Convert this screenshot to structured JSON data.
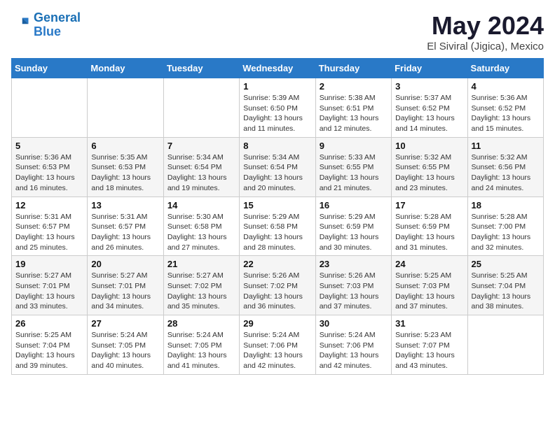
{
  "logo": {
    "line1": "General",
    "line2": "Blue"
  },
  "title": "May 2024",
  "location": "El Siviral (Jigica), Mexico",
  "weekdays": [
    "Sunday",
    "Monday",
    "Tuesday",
    "Wednesday",
    "Thursday",
    "Friday",
    "Saturday"
  ],
  "weeks": [
    [
      {
        "day": "",
        "info": ""
      },
      {
        "day": "",
        "info": ""
      },
      {
        "day": "",
        "info": ""
      },
      {
        "day": "1",
        "info": "Sunrise: 5:39 AM\nSunset: 6:50 PM\nDaylight: 13 hours\nand 11 minutes."
      },
      {
        "day": "2",
        "info": "Sunrise: 5:38 AM\nSunset: 6:51 PM\nDaylight: 13 hours\nand 12 minutes."
      },
      {
        "day": "3",
        "info": "Sunrise: 5:37 AM\nSunset: 6:52 PM\nDaylight: 13 hours\nand 14 minutes."
      },
      {
        "day": "4",
        "info": "Sunrise: 5:36 AM\nSunset: 6:52 PM\nDaylight: 13 hours\nand 15 minutes."
      }
    ],
    [
      {
        "day": "5",
        "info": "Sunrise: 5:36 AM\nSunset: 6:53 PM\nDaylight: 13 hours\nand 16 minutes."
      },
      {
        "day": "6",
        "info": "Sunrise: 5:35 AM\nSunset: 6:53 PM\nDaylight: 13 hours\nand 18 minutes."
      },
      {
        "day": "7",
        "info": "Sunrise: 5:34 AM\nSunset: 6:54 PM\nDaylight: 13 hours\nand 19 minutes."
      },
      {
        "day": "8",
        "info": "Sunrise: 5:34 AM\nSunset: 6:54 PM\nDaylight: 13 hours\nand 20 minutes."
      },
      {
        "day": "9",
        "info": "Sunrise: 5:33 AM\nSunset: 6:55 PM\nDaylight: 13 hours\nand 21 minutes."
      },
      {
        "day": "10",
        "info": "Sunrise: 5:32 AM\nSunset: 6:55 PM\nDaylight: 13 hours\nand 23 minutes."
      },
      {
        "day": "11",
        "info": "Sunrise: 5:32 AM\nSunset: 6:56 PM\nDaylight: 13 hours\nand 24 minutes."
      }
    ],
    [
      {
        "day": "12",
        "info": "Sunrise: 5:31 AM\nSunset: 6:57 PM\nDaylight: 13 hours\nand 25 minutes."
      },
      {
        "day": "13",
        "info": "Sunrise: 5:31 AM\nSunset: 6:57 PM\nDaylight: 13 hours\nand 26 minutes."
      },
      {
        "day": "14",
        "info": "Sunrise: 5:30 AM\nSunset: 6:58 PM\nDaylight: 13 hours\nand 27 minutes."
      },
      {
        "day": "15",
        "info": "Sunrise: 5:29 AM\nSunset: 6:58 PM\nDaylight: 13 hours\nand 28 minutes."
      },
      {
        "day": "16",
        "info": "Sunrise: 5:29 AM\nSunset: 6:59 PM\nDaylight: 13 hours\nand 30 minutes."
      },
      {
        "day": "17",
        "info": "Sunrise: 5:28 AM\nSunset: 6:59 PM\nDaylight: 13 hours\nand 31 minutes."
      },
      {
        "day": "18",
        "info": "Sunrise: 5:28 AM\nSunset: 7:00 PM\nDaylight: 13 hours\nand 32 minutes."
      }
    ],
    [
      {
        "day": "19",
        "info": "Sunrise: 5:27 AM\nSunset: 7:01 PM\nDaylight: 13 hours\nand 33 minutes."
      },
      {
        "day": "20",
        "info": "Sunrise: 5:27 AM\nSunset: 7:01 PM\nDaylight: 13 hours\nand 34 minutes."
      },
      {
        "day": "21",
        "info": "Sunrise: 5:27 AM\nSunset: 7:02 PM\nDaylight: 13 hours\nand 35 minutes."
      },
      {
        "day": "22",
        "info": "Sunrise: 5:26 AM\nSunset: 7:02 PM\nDaylight: 13 hours\nand 36 minutes."
      },
      {
        "day": "23",
        "info": "Sunrise: 5:26 AM\nSunset: 7:03 PM\nDaylight: 13 hours\nand 37 minutes."
      },
      {
        "day": "24",
        "info": "Sunrise: 5:25 AM\nSunset: 7:03 PM\nDaylight: 13 hours\nand 37 minutes."
      },
      {
        "day": "25",
        "info": "Sunrise: 5:25 AM\nSunset: 7:04 PM\nDaylight: 13 hours\nand 38 minutes."
      }
    ],
    [
      {
        "day": "26",
        "info": "Sunrise: 5:25 AM\nSunset: 7:04 PM\nDaylight: 13 hours\nand 39 minutes."
      },
      {
        "day": "27",
        "info": "Sunrise: 5:24 AM\nSunset: 7:05 PM\nDaylight: 13 hours\nand 40 minutes."
      },
      {
        "day": "28",
        "info": "Sunrise: 5:24 AM\nSunset: 7:05 PM\nDaylight: 13 hours\nand 41 minutes."
      },
      {
        "day": "29",
        "info": "Sunrise: 5:24 AM\nSunset: 7:06 PM\nDaylight: 13 hours\nand 42 minutes."
      },
      {
        "day": "30",
        "info": "Sunrise: 5:24 AM\nSunset: 7:06 PM\nDaylight: 13 hours\nand 42 minutes."
      },
      {
        "day": "31",
        "info": "Sunrise: 5:23 AM\nSunset: 7:07 PM\nDaylight: 13 hours\nand 43 minutes."
      },
      {
        "day": "",
        "info": ""
      }
    ]
  ]
}
